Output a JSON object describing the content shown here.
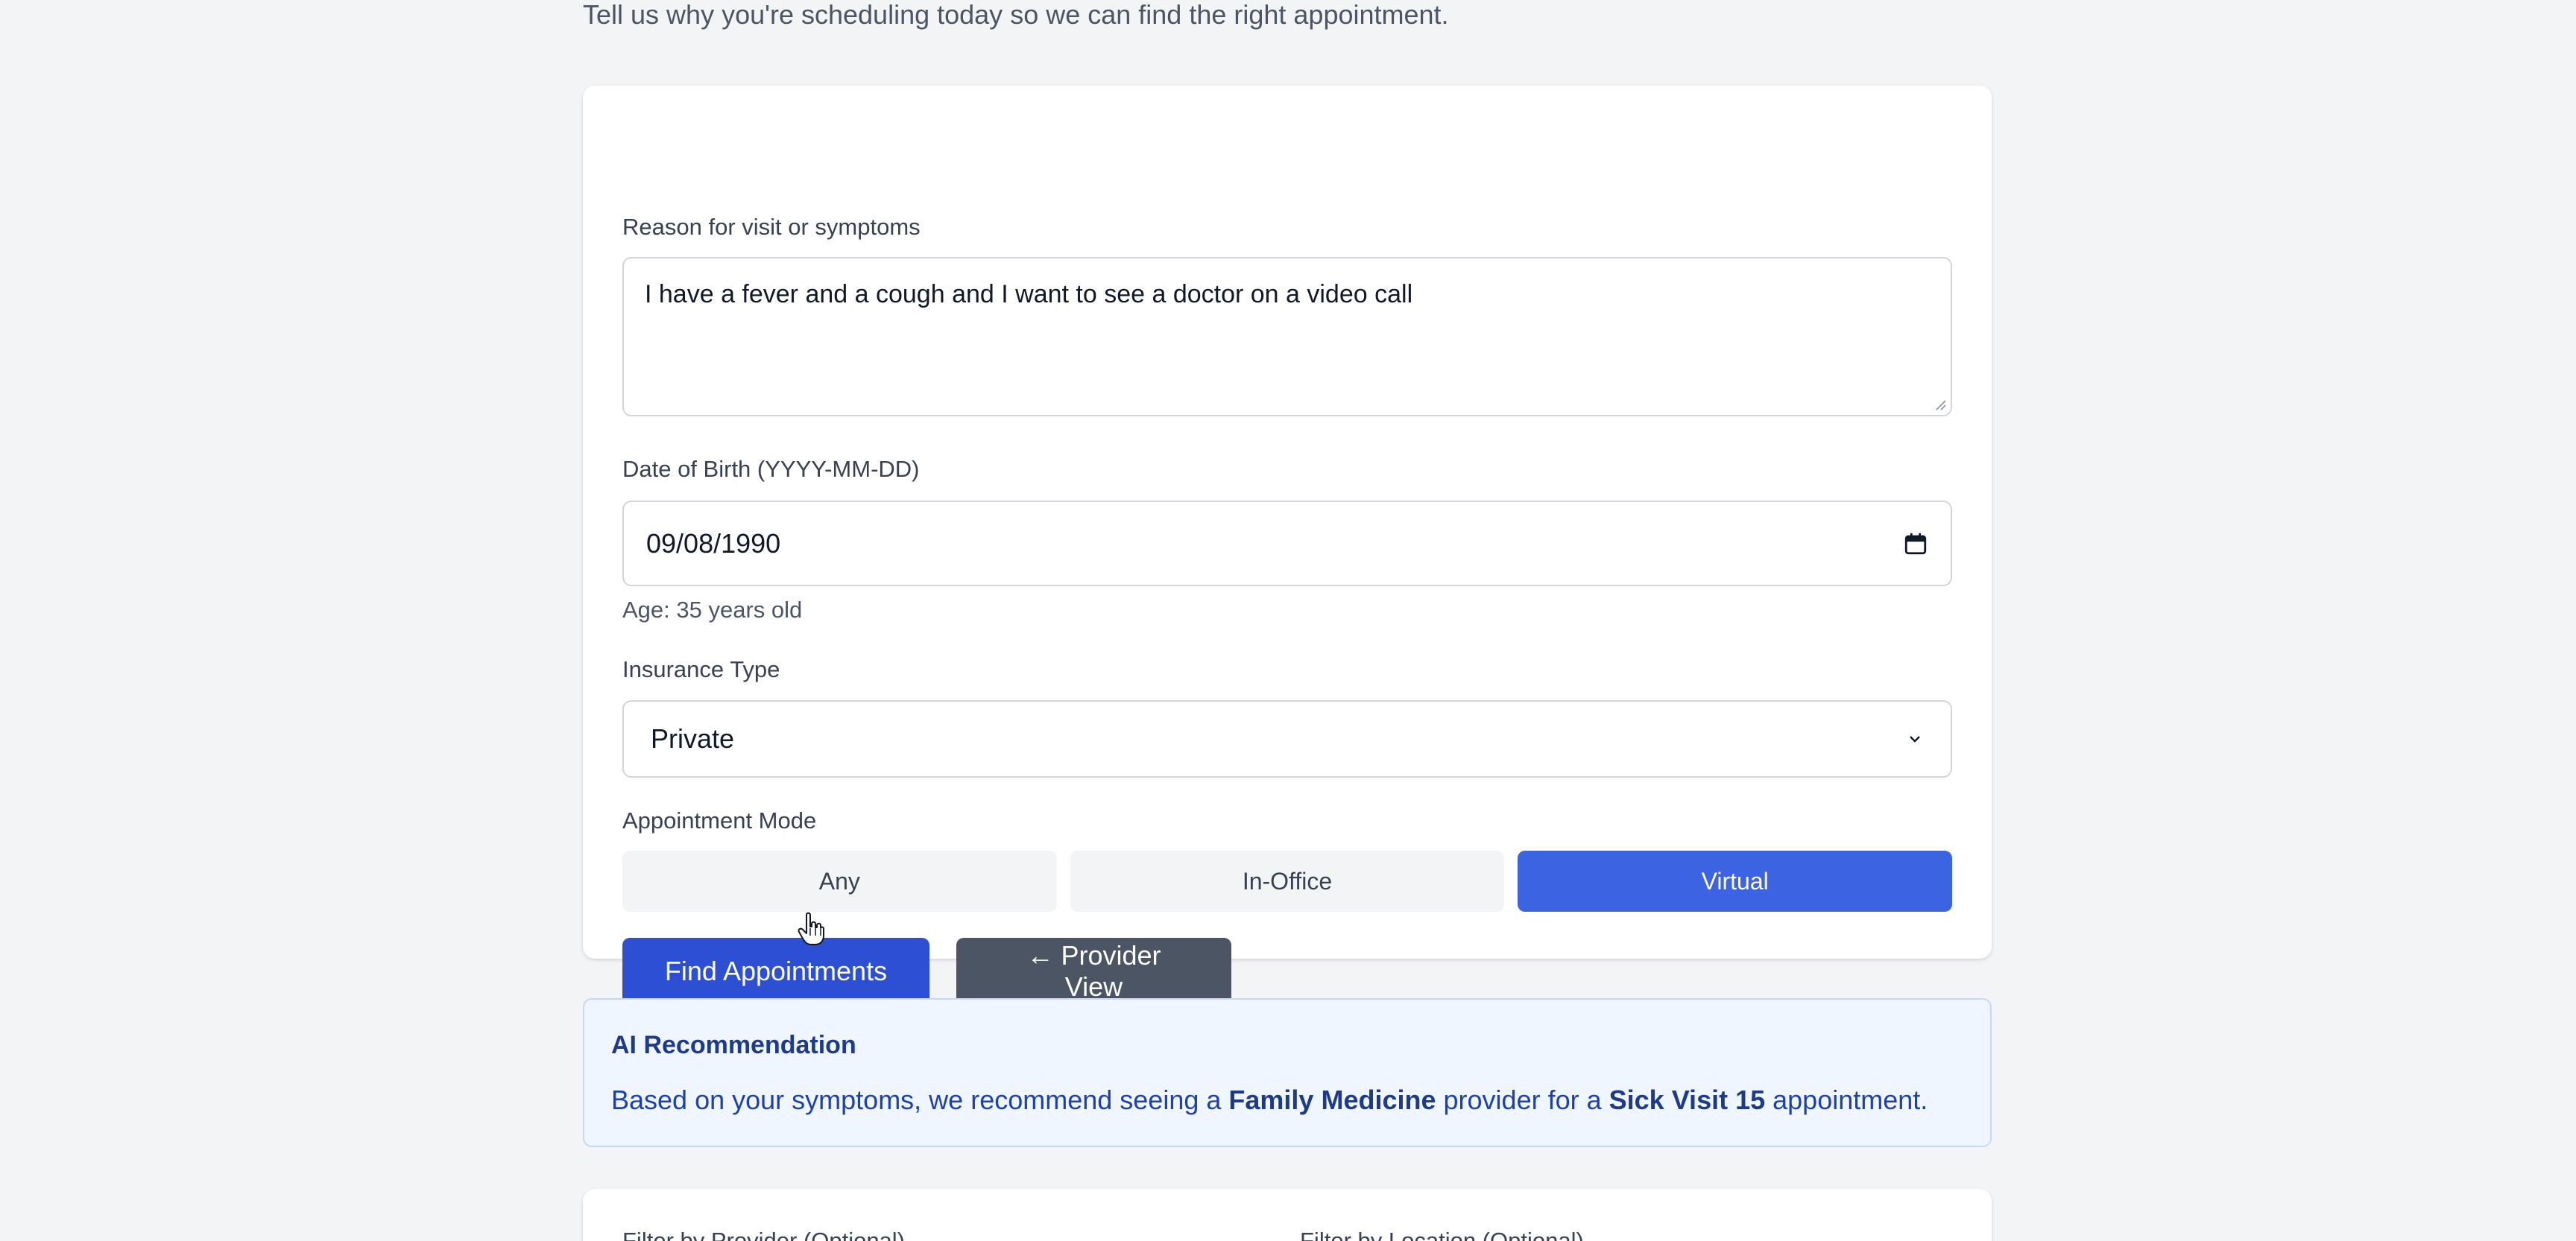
{
  "header": {
    "subtitle": "Tell us why you're scheduling today so we can find the right appointment."
  },
  "form": {
    "reason_label": "Reason for visit or symptoms",
    "reason_value": "I have a fever and a cough and I want to see a doctor on a video call",
    "dob_label": "Date of Birth (YYYY-MM-DD)",
    "dob_value": "09/08/1990",
    "age_hint": "Age: 35 years old",
    "insurance_label": "Insurance Type",
    "insurance_value": "Private",
    "mode_label": "Appointment Mode",
    "modes": [
      {
        "label": "Any",
        "active": false
      },
      {
        "label": "In-Office",
        "active": false
      },
      {
        "label": "Virtual",
        "active": true
      }
    ],
    "find_button": "Find Appointments",
    "provider_view_button": "← Provider View"
  },
  "ai": {
    "title": "AI Recommendation",
    "text_prefix": "Based on your symptoms, we recommend seeing a",
    "specialty": "Family Medicine",
    "text_middle": "provider for a",
    "visit_type": "Sick Visit 15",
    "text_suffix": "appointment."
  },
  "filters": {
    "provider_label": "Filter by Provider (Optional)",
    "location_label": "Filter by Location (Optional)"
  },
  "colors": {
    "primary": "#2d4fd4",
    "active_mode": "#3b63e2",
    "secondary": "#4b5563",
    "ai_bg": "#eff6ff"
  }
}
